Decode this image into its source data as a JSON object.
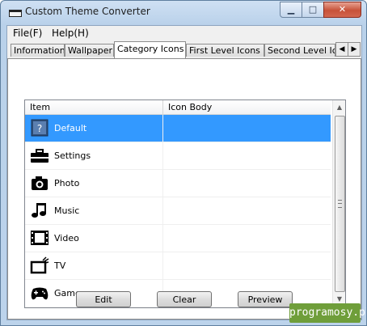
{
  "window": {
    "title": "Custom Theme Converter"
  },
  "window_controls": {
    "minimize": "▁",
    "maximize": "□",
    "close": "✕"
  },
  "menu": {
    "items": [
      "File(F)",
      "Help(H)"
    ]
  },
  "tabs": {
    "items": [
      "Information",
      "Wallpaper",
      "Category Icons",
      "First Level Icons",
      "Second Level Ic"
    ],
    "active": "Category Icons",
    "scroll_left": "◀",
    "scroll_right": "▶"
  },
  "list": {
    "columns": [
      "Item",
      "Icon Body"
    ],
    "rows": [
      {
        "label": "Default",
        "icon": "question-icon",
        "glyph": "?",
        "icon_body": "",
        "selected": true
      },
      {
        "label": "Settings",
        "icon": "toolbox-icon",
        "glyph": "🧰",
        "icon_body": ""
      },
      {
        "label": "Photo",
        "icon": "camera-icon",
        "glyph": "📷",
        "icon_body": ""
      },
      {
        "label": "Music",
        "icon": "music-note-icon",
        "glyph": "♫",
        "icon_body": ""
      },
      {
        "label": "Video",
        "icon": "film-icon",
        "glyph": "🎞",
        "icon_body": ""
      },
      {
        "label": "TV",
        "icon": "tv-icon",
        "glyph": "📺",
        "icon_body": ""
      },
      {
        "label": "Game",
        "icon": "gamepad-icon",
        "glyph": "🎮",
        "icon_body": ""
      }
    ],
    "scroll_up": "▲",
    "scroll_down": "▼"
  },
  "buttons": {
    "edit": "Edit",
    "clear": "Clear",
    "preview": "Preview"
  },
  "watermark": "programosy.pl",
  "colors": {
    "selection": "#3399ff",
    "watermark_bg": "#6f9e3a"
  }
}
